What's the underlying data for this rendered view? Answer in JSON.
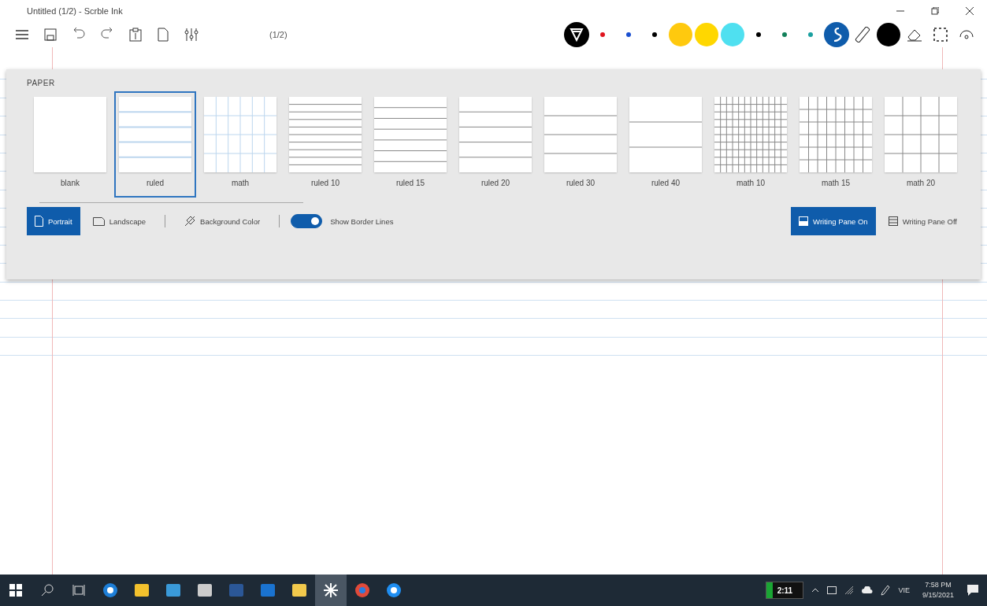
{
  "window": {
    "title": "Untitled (1/2) - Scrble Ink"
  },
  "toolbar": {
    "page_indicator": "(1/2)"
  },
  "pens": [
    {
      "kind": "filter",
      "color": "#000000",
      "selected": false
    },
    {
      "kind": "dot",
      "color": "#e0141e",
      "selected": false
    },
    {
      "kind": "dot",
      "color": "#1a4fd0",
      "selected": false
    },
    {
      "kind": "dot",
      "color": "#000000",
      "selected": false
    },
    {
      "kind": "disc",
      "color": "#ffc90e",
      "selected": false
    },
    {
      "kind": "disc",
      "color": "#ffd700",
      "selected": false
    },
    {
      "kind": "disc",
      "color": "#4fe0f0",
      "selected": false
    },
    {
      "kind": "dot",
      "color": "#000000",
      "selected": false
    },
    {
      "kind": "dot",
      "color": "#12805a",
      "selected": false
    },
    {
      "kind": "dot",
      "color": "#1aa0a0",
      "selected": false
    },
    {
      "kind": "pen",
      "color": "#0f5cab",
      "selected": true
    },
    {
      "kind": "ruler",
      "selected": false
    },
    {
      "kind": "disc",
      "color": "#000000",
      "selected": false
    },
    {
      "kind": "eraser",
      "selected": false
    },
    {
      "kind": "lasso",
      "selected": false
    },
    {
      "kind": "touch",
      "selected": false
    }
  ],
  "paper": {
    "heading": "PAPER",
    "papers": [
      {
        "label": "blank",
        "kind": "blank",
        "selected": false
      },
      {
        "label": "ruled",
        "kind": "ruled",
        "selected": true
      },
      {
        "label": "math",
        "kind": "math",
        "selected": false
      },
      {
        "label": "ruled 10",
        "kind": "ruled10",
        "selected": false
      },
      {
        "label": "ruled 15",
        "kind": "ruled15",
        "selected": false
      },
      {
        "label": "ruled 20",
        "kind": "ruled20",
        "selected": false
      },
      {
        "label": "ruled 30",
        "kind": "ruled30",
        "selected": false
      },
      {
        "label": "ruled 40",
        "kind": "ruled40",
        "selected": false
      },
      {
        "label": "math 10",
        "kind": "math10",
        "selected": false
      },
      {
        "label": "math 15",
        "kind": "math15",
        "selected": false
      },
      {
        "label": "math 20",
        "kind": "math20",
        "selected": false
      }
    ],
    "orientation": [
      {
        "label": "Portrait",
        "kind": "portrait",
        "selected": true
      },
      {
        "label": "Landscape",
        "kind": "landscape",
        "selected": false
      }
    ],
    "background_color": "Background Color",
    "border_lines": {
      "label": "Show Border Lines",
      "on": true
    },
    "writing_pane": [
      {
        "label": "Writing Pane On",
        "kind": "on",
        "selected": true
      },
      {
        "label": "Writing Pane Off",
        "kind": "off",
        "selected": false
      }
    ]
  },
  "taskbar": {
    "apps": [
      {
        "kind": "search"
      },
      {
        "kind": "taskview"
      },
      {
        "kind": "edge"
      },
      {
        "kind": "store"
      },
      {
        "kind": "sigma"
      },
      {
        "kind": "tool"
      },
      {
        "kind": "word"
      },
      {
        "kind": "mail"
      },
      {
        "kind": "explorer"
      },
      {
        "kind": "ink",
        "selected": true
      },
      {
        "kind": "chrome"
      },
      {
        "kind": "zalo"
      }
    ],
    "battery": "2:11",
    "language": "VIE",
    "time": "7:58 PM",
    "date": "9/15/2021"
  }
}
